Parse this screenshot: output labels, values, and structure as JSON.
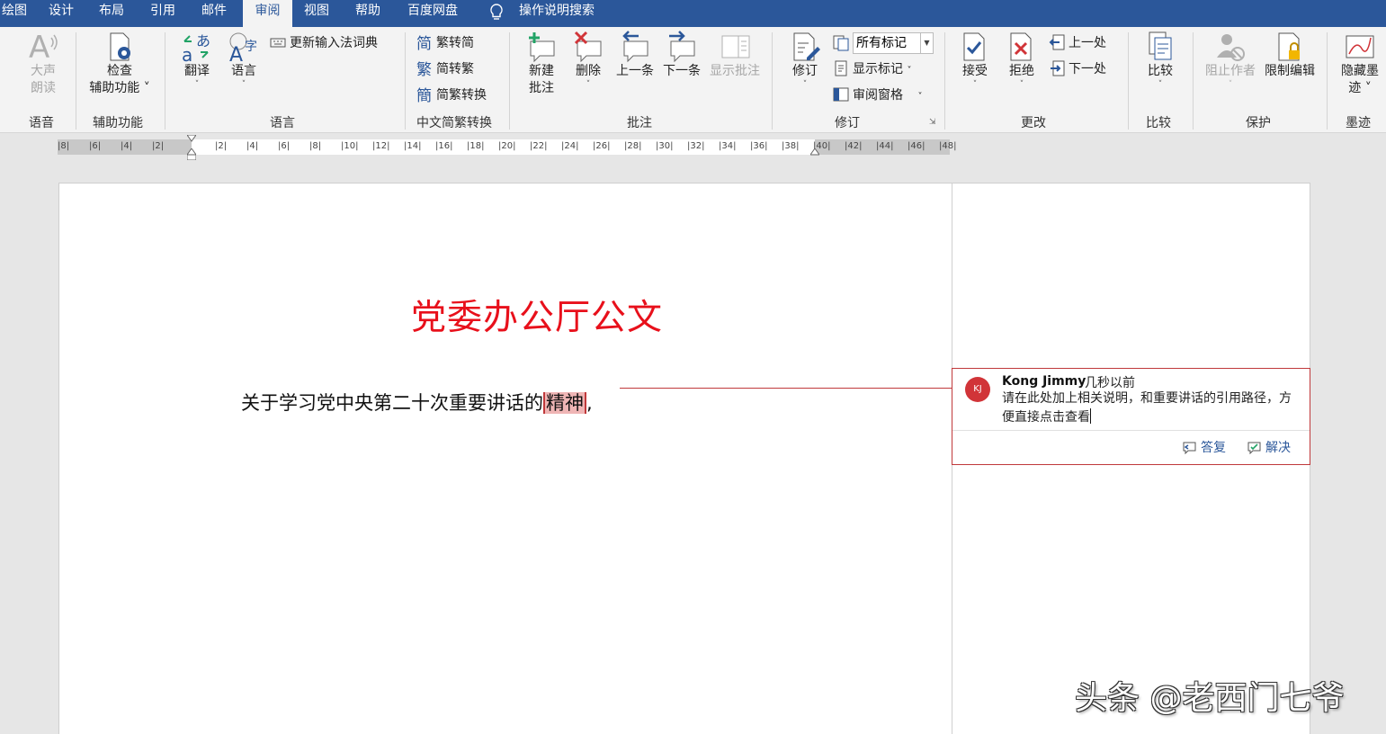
{
  "menu": {
    "tabs": [
      "绘图",
      "设计",
      "布局",
      "引用",
      "邮件",
      "审阅",
      "视图",
      "帮助",
      "百度网盘"
    ],
    "active_tab": "审阅",
    "tell_me": "操作说明搜索"
  },
  "ribbon": {
    "speech": {
      "read_aloud": [
        "大声",
        "朗读"
      ],
      "group": "语音"
    },
    "accessibility": {
      "check": [
        "检查",
        "辅助功能"
      ],
      "group": "辅助功能"
    },
    "language": {
      "translate": "翻译",
      "language": "语言",
      "update_ime": "更新输入法词典",
      "group": "语言"
    },
    "chinese": {
      "to_simplified": "繁转简",
      "to_traditional": "简转繁",
      "convert": "简繁转换",
      "group": "中文简繁转换"
    },
    "comments": {
      "new": [
        "新建",
        "批注"
      ],
      "delete": "删除",
      "previous": "上一条",
      "next": "下一条",
      "show": "显示批注",
      "group": "批注"
    },
    "tracking": {
      "track_changes": "修订",
      "display_for_review": "所有标记",
      "show_markup": "显示标记",
      "reviewing_pane": "审阅窗格",
      "group": "修订"
    },
    "changes": {
      "accept": "接受",
      "reject": "拒绝",
      "previous": "上一处",
      "next": "下一处",
      "group": "更改"
    },
    "compare": {
      "compare": "比较",
      "group": "比较"
    },
    "protect": {
      "block_authors": "阻止作者",
      "restrict_editing": "限制编辑",
      "group": "保护"
    },
    "ink": {
      "hide_ink": [
        "隐藏墨",
        "迹"
      ],
      "group": "墨迹"
    }
  },
  "ruler": {
    "ticks": [
      "8",
      "6",
      "4",
      "2",
      "",
      "2",
      "4",
      "6",
      "8",
      "10",
      "12",
      "14",
      "16",
      "18",
      "20",
      "22",
      "24",
      "26",
      "28",
      "30",
      "32",
      "34",
      "36",
      "38",
      "40",
      "42",
      "44",
      "46",
      "48"
    ]
  },
  "document": {
    "title": "党委办公厅公文",
    "paragraph_before": "关于学习党中央第二十次重要讲话的",
    "commented_word": "精神",
    "paragraph_after": ","
  },
  "comment": {
    "avatar_initials": "KJ",
    "author": "Kong Jimmy",
    "time": "几秒以前",
    "text": "请在此处加上相关说明，和重要讲话的引用路径，方便直接点击查看",
    "reply": "答复",
    "resolve": "解决"
  },
  "colors": {
    "menubar": "#2b579a",
    "title_red": "#e8101b",
    "comment_border": "#c0393b",
    "highlight": "#efb5b5"
  },
  "watermark": "头条 @老西门七爷"
}
